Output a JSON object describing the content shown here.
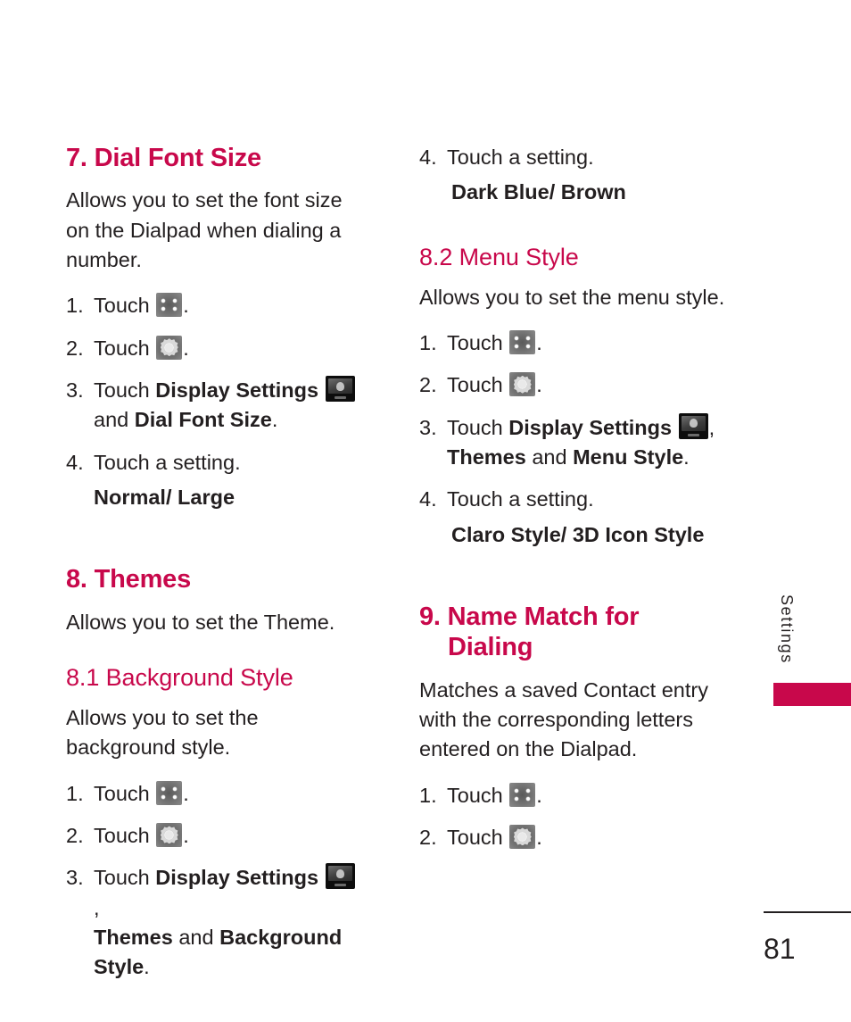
{
  "page": {
    "number": "81",
    "side_tab_label": "Settings",
    "accent_color": "#c8084b",
    "text_color": "#231f20"
  },
  "icons": {
    "grid": "grid-menu-icon",
    "gear": "settings-gear-icon",
    "display": "display-settings-icon"
  },
  "left_column": {
    "section_7": {
      "heading": "7. Dial Font Size",
      "intro": "Allows you to set the font size on the Dialpad when dialing a number.",
      "steps": [
        {
          "num": "1.",
          "text": "Touch",
          "icon": "grid",
          "trailing": "."
        },
        {
          "num": "2.",
          "text": "Touch",
          "icon": "gear",
          "trailing": "."
        },
        {
          "num": "3.",
          "text": "Touch",
          "bold1": "Display Settings",
          "icon": "display",
          "trailing": "",
          "line2_pre": "and ",
          "line2_bold": "Dial Font Size",
          "line2_post": "."
        },
        {
          "num": "4.",
          "text": "Touch a setting."
        }
      ],
      "options": "Normal/ Large"
    },
    "section_8": {
      "heading": "8. Themes",
      "intro": "Allows you to set the Theme."
    },
    "section_8_1": {
      "heading": "8.1 Background Style",
      "intro": "Allows you to set the background style.",
      "steps": [
        {
          "num": "1.",
          "text": "Touch",
          "icon": "grid",
          "trailing": "."
        },
        {
          "num": "2.",
          "text": "Touch",
          "icon": "gear",
          "trailing": "."
        },
        {
          "num": "3.",
          "text": "Touch",
          "bold1": "Display Settings",
          "icon": "display",
          "trailing": ",",
          "line2_bold_a": "Themes",
          "line2_mid": " and ",
          "line2_bold_b": "Background",
          "line3_bold": "Style",
          "line3_post": "."
        }
      ]
    }
  },
  "right_column": {
    "section_8_1_cont": {
      "step4": {
        "num": "4.",
        "text": "Touch a setting."
      },
      "options": "Dark Blue/ Brown"
    },
    "section_8_2": {
      "heading": "8.2 Menu Style",
      "intro": "Allows you to set the menu style.",
      "steps": [
        {
          "num": "1.",
          "text": "Touch",
          "icon": "grid",
          "trailing": "."
        },
        {
          "num": "2.",
          "text": "Touch",
          "icon": "gear",
          "trailing": "."
        },
        {
          "num": "3.",
          "text": "Touch",
          "bold1": "Display Settings",
          "icon": "display",
          "trailing": ",",
          "line2_bold_a": "Themes",
          "line2_mid": " and ",
          "line2_bold_b": "Menu Style",
          "line2_post": "."
        },
        {
          "num": "4.",
          "text": "Touch a setting."
        }
      ],
      "options": "Claro Style/ 3D Icon Style"
    },
    "section_9": {
      "heading_line1": "9. Name Match for",
      "heading_line2": "Dialing",
      "intro": "Matches a saved Contact entry with the corresponding letters entered on the Dialpad.",
      "steps": [
        {
          "num": "1.",
          "text": "Touch",
          "icon": "grid",
          "trailing": "."
        },
        {
          "num": "2.",
          "text": "Touch",
          "icon": "gear",
          "trailing": "."
        }
      ]
    }
  }
}
